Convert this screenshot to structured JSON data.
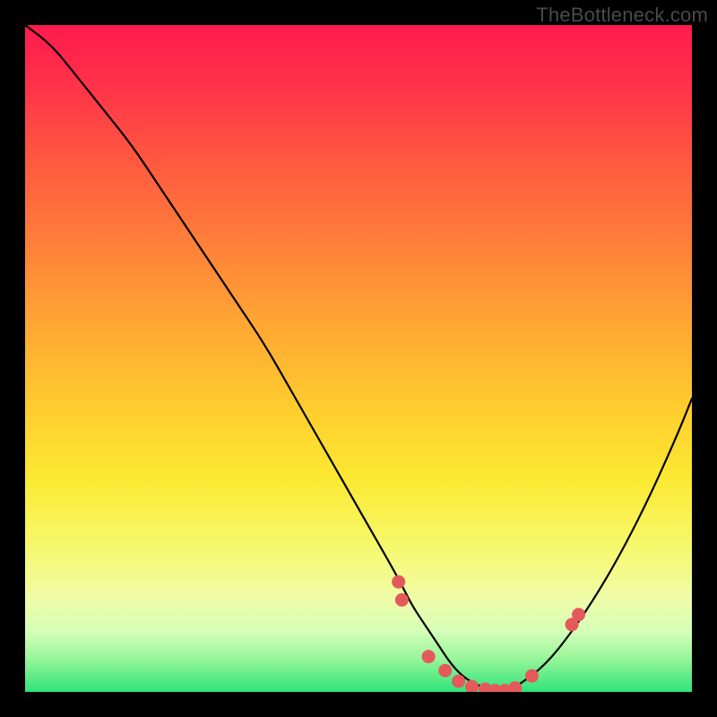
{
  "watermark": "TheBottleneck.com",
  "chart_data": {
    "type": "line",
    "title": "",
    "xlabel": "",
    "ylabel": "",
    "xlim": [
      0,
      100
    ],
    "ylim": [
      0,
      100
    ],
    "series": [
      {
        "name": "bottleneck-curve",
        "x": [
          0,
          4,
          8,
          12,
          16,
          20,
          24,
          28,
          32,
          36,
          40,
          44,
          48,
          52,
          56,
          58,
          60,
          62,
          64,
          66,
          68,
          70,
          72,
          74,
          78,
          82,
          86,
          90,
          94,
          98,
          100
        ],
        "y": [
          100,
          97,
          92,
          87,
          82,
          76,
          70,
          64,
          58,
          52,
          45,
          38,
          31,
          24,
          17,
          13,
          10,
          7,
          4,
          2,
          1,
          0,
          0,
          1,
          4,
          9,
          15,
          22,
          30,
          39,
          44
        ]
      }
    ],
    "markers": {
      "name": "highlight-points",
      "color": "#e45a5a",
      "x": [
        56,
        56.5,
        60.5,
        63,
        65,
        67,
        69,
        70.5,
        72,
        73.5,
        76,
        82,
        83
      ],
      "y": [
        16.5,
        13.8,
        5.3,
        3.2,
        1.6,
        0.8,
        0.4,
        0.2,
        0.2,
        0.6,
        2.4,
        10.1,
        11.6
      ]
    },
    "gradient_stops": [
      {
        "offset": 0,
        "color": "#ff1a4d"
      },
      {
        "offset": 8,
        "color": "#ff2f4a"
      },
      {
        "offset": 20,
        "color": "#ff5740"
      },
      {
        "offset": 32,
        "color": "#ff7d3a"
      },
      {
        "offset": 45,
        "color": "#ffa733"
      },
      {
        "offset": 58,
        "color": "#ffce2e"
      },
      {
        "offset": 68,
        "color": "#fbe932"
      },
      {
        "offset": 78,
        "color": "#f6f86b"
      },
      {
        "offset": 86,
        "color": "#f0fca8"
      },
      {
        "offset": 91,
        "color": "#d4ffb8"
      },
      {
        "offset": 95,
        "color": "#98f59a"
      },
      {
        "offset": 100,
        "color": "#2fe47a"
      }
    ]
  }
}
